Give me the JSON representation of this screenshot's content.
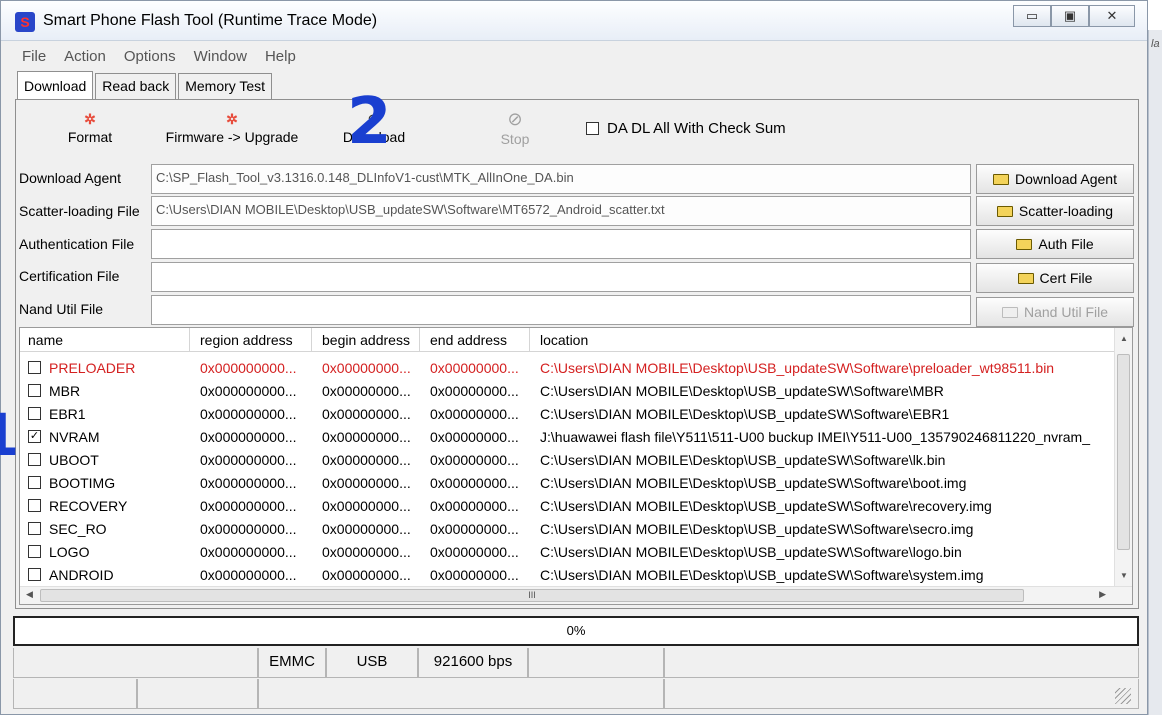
{
  "window": {
    "title": "Smart Phone Flash Tool (Runtime Trace Mode)",
    "controls": {
      "minimize": "▭",
      "maximize": "▣",
      "close": "✕"
    },
    "side_fragment": "la"
  },
  "menu": {
    "items": [
      "File",
      "Action",
      "Options",
      "Window",
      "Help"
    ]
  },
  "tabs": [
    {
      "label": "Download",
      "active": true
    },
    {
      "label": "Read back",
      "active": false
    },
    {
      "label": "Memory Test",
      "active": false
    }
  ],
  "toolbar": {
    "format": "Format",
    "firmware_upgrade": "Firmware -> Upgrade",
    "download": "Download",
    "stop": "Stop",
    "da_dl_checksum": "DA DL All With Check Sum",
    "da_dl_checked": false
  },
  "annotations": {
    "one": "1",
    "two": "2"
  },
  "fields": [
    {
      "label": "Download Agent",
      "value": "C:\\SP_Flash_Tool_v3.1316.0.148_DLInfoV1-cust\\MTK_AllInOne_DA.bin",
      "button": "Download Agent",
      "enabled": true
    },
    {
      "label": "Scatter-loading File",
      "value": "C:\\Users\\DIAN MOBILE\\Desktop\\USB_updateSW\\Software\\MT6572_Android_scatter.txt",
      "button": "Scatter-loading",
      "enabled": true
    },
    {
      "label": "Authentication File",
      "value": "",
      "button": "Auth File",
      "enabled": true
    },
    {
      "label": "Certification File",
      "value": "",
      "button": "Cert File",
      "enabled": true
    },
    {
      "label": "Nand Util File",
      "value": "",
      "button": "Nand Util File",
      "enabled": false
    }
  ],
  "table": {
    "headers": [
      "name",
      "region address",
      "begin address",
      "end address",
      "location"
    ],
    "rows": [
      {
        "checked": false,
        "name": "PRELOADER",
        "region": "0x000000000...",
        "begin": "0x00000000...",
        "end": "0x00000000...",
        "location": "C:\\Users\\DIAN MOBILE\\Desktop\\USB_updateSW\\Software\\preloader_wt98511.bin",
        "highlight": true
      },
      {
        "checked": false,
        "name": "MBR",
        "region": "0x000000000...",
        "begin": "0x00000000...",
        "end": "0x00000000...",
        "location": "C:\\Users\\DIAN MOBILE\\Desktop\\USB_updateSW\\Software\\MBR",
        "highlight": false
      },
      {
        "checked": false,
        "name": "EBR1",
        "region": "0x000000000...",
        "begin": "0x00000000...",
        "end": "0x00000000...",
        "location": "C:\\Users\\DIAN MOBILE\\Desktop\\USB_updateSW\\Software\\EBR1",
        "highlight": false
      },
      {
        "checked": true,
        "name": "NVRAM",
        "region": "0x000000000...",
        "begin": "0x00000000...",
        "end": "0x00000000...",
        "location": "J:\\huawawei flash file\\Y511\\511-U00 buckup IMEI\\Y511-U00_135790246811220_nvram_",
        "highlight": false
      },
      {
        "checked": false,
        "name": "UBOOT",
        "region": "0x000000000...",
        "begin": "0x00000000...",
        "end": "0x00000000...",
        "location": "C:\\Users\\DIAN MOBILE\\Desktop\\USB_updateSW\\Software\\lk.bin",
        "highlight": false
      },
      {
        "checked": false,
        "name": "BOOTIMG",
        "region": "0x000000000...",
        "begin": "0x00000000...",
        "end": "0x00000000...",
        "location": "C:\\Users\\DIAN MOBILE\\Desktop\\USB_updateSW\\Software\\boot.img",
        "highlight": false
      },
      {
        "checked": false,
        "name": "RECOVERY",
        "region": "0x000000000...",
        "begin": "0x00000000...",
        "end": "0x00000000...",
        "location": "C:\\Users\\DIAN MOBILE\\Desktop\\USB_updateSW\\Software\\recovery.img",
        "highlight": false
      },
      {
        "checked": false,
        "name": "SEC_RO",
        "region": "0x000000000...",
        "begin": "0x00000000...",
        "end": "0x00000000...",
        "location": "C:\\Users\\DIAN MOBILE\\Desktop\\USB_updateSW\\Software\\secro.img",
        "highlight": false
      },
      {
        "checked": false,
        "name": "LOGO",
        "region": "0x000000000...",
        "begin": "0x00000000...",
        "end": "0x00000000...",
        "location": "C:\\Users\\DIAN MOBILE\\Desktop\\USB_updateSW\\Software\\logo.bin",
        "highlight": false
      },
      {
        "checked": false,
        "name": "ANDROID",
        "region": "0x000000000...",
        "begin": "0x00000000...",
        "end": "0x00000000...",
        "location": "C:\\Users\\DIAN MOBILE\\Desktop\\USB_updateSW\\Software\\system.img",
        "highlight": false
      }
    ],
    "hscroll_grip": "III"
  },
  "progress": {
    "text": "0%",
    "value": 0
  },
  "status": {
    "storage": "EMMC",
    "port": "USB",
    "baud": "921600 bps"
  },
  "icons": {
    "format": "format-icon",
    "firmware": "firmware-upgrade-icon",
    "download": "download-icon",
    "stop": "stop-icon",
    "folder": "folder-icon"
  },
  "colors": {
    "highlight_row": "#d42020",
    "annotation": "#1a3fd0"
  }
}
